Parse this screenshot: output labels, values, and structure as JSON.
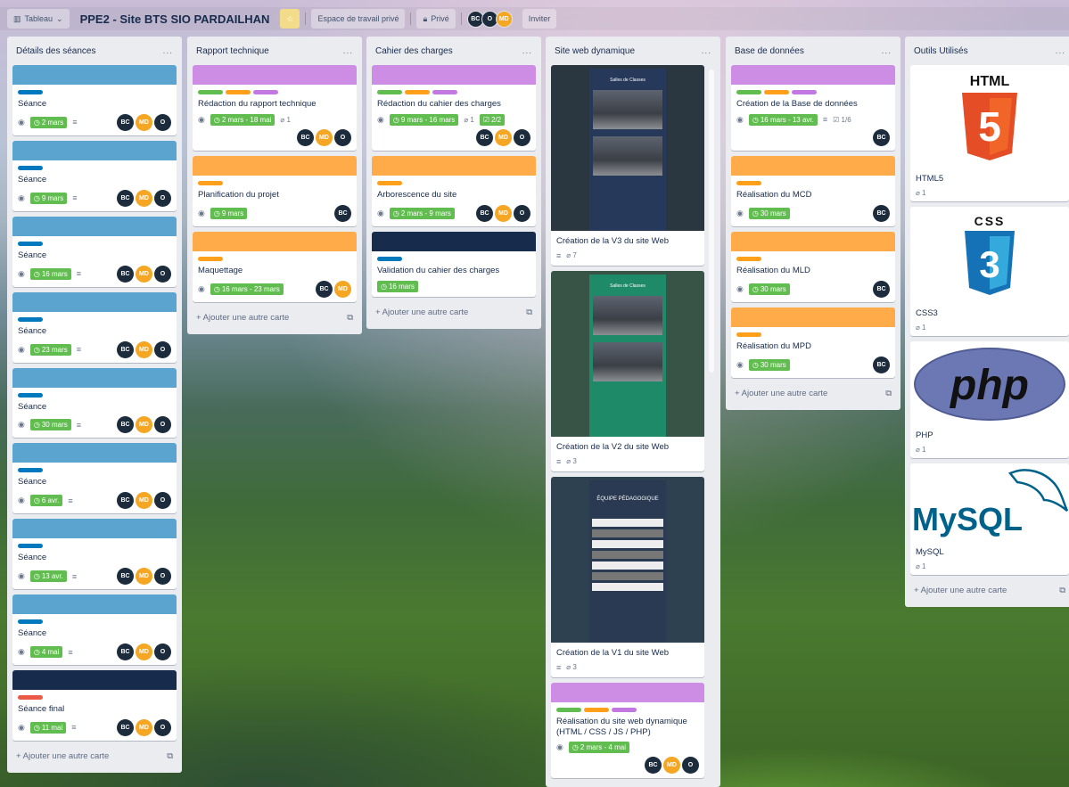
{
  "header": {
    "board_switch": "Tableau",
    "board_title": "PPE2 - Site BTS SIO PARDAILHAN",
    "workspace": "Espace de travail privé",
    "visibility": "Privé",
    "members": [
      "BC",
      "O",
      "MD"
    ],
    "invite": "Inviter"
  },
  "common": {
    "add_card": "Ajouter une autre carte",
    "menu": "..."
  },
  "lists": {
    "seances": {
      "title": "Détails des séances",
      "cards": [
        {
          "title": "Séance",
          "due": "2 mars"
        },
        {
          "title": "Séance",
          "due": "9 mars"
        },
        {
          "title": "Séance",
          "due": "16 mars"
        },
        {
          "title": "Séance",
          "due": "23 mars"
        },
        {
          "title": "Séance",
          "due": "30 mars"
        },
        {
          "title": "Séance",
          "due": "6 avr."
        },
        {
          "title": "Séance",
          "due": "13 avr."
        },
        {
          "title": "Séance",
          "due": "4 mai"
        },
        {
          "title": "Séance final",
          "due": "11 mai"
        }
      ]
    },
    "rapport": {
      "title": "Rapport technique",
      "cards": [
        {
          "title": "Rédaction du rapport technique",
          "due": "2 mars - 18 mai",
          "attachments": "1"
        },
        {
          "title": "Planification du projet",
          "due": "9 mars"
        },
        {
          "title": "Maquettage",
          "due": "16 mars - 23 mars"
        }
      ]
    },
    "cahier": {
      "title": "Cahier des charges",
      "cards": [
        {
          "title": "Rédaction du cahier des charges",
          "due": "9 mars - 16 mars",
          "attachments": "1",
          "checklist": "2/2"
        },
        {
          "title": "Arborescence du site",
          "due": "2 mars - 9 mars"
        },
        {
          "title": "Validation du cahier des charges",
          "due": "16 mars"
        }
      ]
    },
    "siteweb": {
      "title": "Site web dynamique",
      "cards": [
        {
          "title": "Création de la V3 du site Web",
          "attachments": "7",
          "mock_title": "Salles de Classes"
        },
        {
          "title": "Création de la V2 du site Web",
          "attachments": "3",
          "mock_title": "Salles de Classes"
        },
        {
          "title": "Création de la V1 du site Web",
          "attachments": "3",
          "mock_title": "ÉQUIPE PÉDAGOGIQUE"
        },
        {
          "title": "Réalisation du site web dynamique (HTML / CSS / JS / PHP)",
          "due": "2 mars - 4 mai"
        }
      ]
    },
    "bdd": {
      "title": "Base de données",
      "cards": [
        {
          "title": "Création de la Base de données",
          "due": "16 mars - 13 avr.",
          "checklist": "1/6"
        },
        {
          "title": "Réalisation du MCD",
          "due": "30 mars"
        },
        {
          "title": "Réalisation du MLD",
          "due": "30 mars"
        },
        {
          "title": "Réalisation du MPD",
          "due": "30 mars"
        }
      ]
    },
    "outils": {
      "title": "Outils Utilisés",
      "cards": [
        {
          "title": "HTML5",
          "attachments": "1",
          "logo_text": "HTML",
          "logo_num": "5"
        },
        {
          "title": "CSS3",
          "attachments": "1",
          "logo_text": "CSS",
          "logo_num": "3"
        },
        {
          "title": "PHP",
          "attachments": "1",
          "logo_text": "php"
        },
        {
          "title": "MySQL",
          "attachments": "1",
          "logo_text": "MySQL"
        }
      ]
    }
  },
  "colors": {
    "label_blue": "#0079bf",
    "label_green": "#61bd4f",
    "label_orange": "#ff9f1a",
    "label_purple": "#c377e0",
    "label_red": "#eb5a46",
    "due_green": "#61bd4f",
    "member_dark": "#1c2c3d",
    "member_orange": "#f5a623"
  }
}
